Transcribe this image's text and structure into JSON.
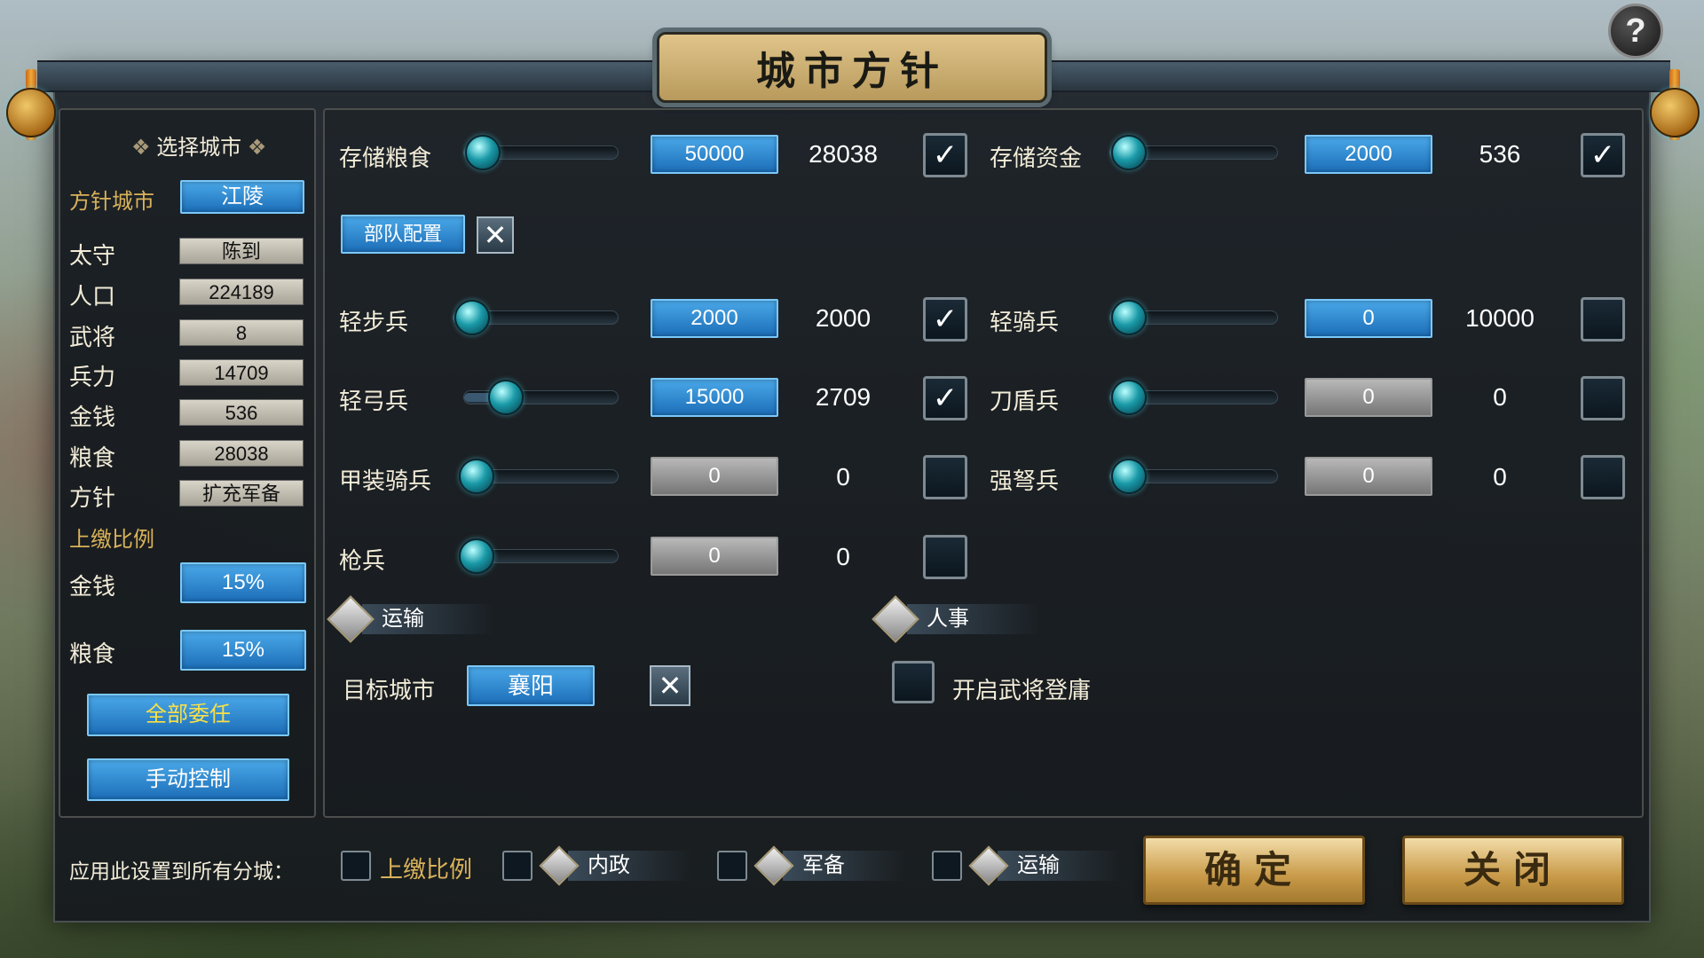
{
  "title": "城市方针",
  "help": "?",
  "left": {
    "header": "选择城市",
    "policy_city_label": "方针城市",
    "policy_city": "江陵",
    "stats": [
      {
        "label": "太守",
        "value": "陈到"
      },
      {
        "label": "人口",
        "value": "224189"
      },
      {
        "label": "武将",
        "value": "8"
      },
      {
        "label": "兵力",
        "value": "14709"
      },
      {
        "label": "金钱",
        "value": "536"
      },
      {
        "label": "粮食",
        "value": "28038"
      },
      {
        "label": "方针",
        "value": "扩充军备"
      }
    ],
    "tribute_header": "上缴比例",
    "tribute": [
      {
        "label": "金钱",
        "value": "15%"
      },
      {
        "label": "粮食",
        "value": "15%"
      }
    ],
    "delegate_all": "全部委任",
    "manual": "手动控制"
  },
  "main": {
    "store_food": {
      "label": "存储粮食",
      "target": "50000",
      "current": "28038",
      "checked": "✓",
      "level": 0.05
    },
    "store_money": {
      "label": "存储资金",
      "target": "2000",
      "current": "536",
      "checked": "✓",
      "level": 0.05
    },
    "troop_config": "部队配置",
    "troop_close": "✕",
    "troops": [
      {
        "label": "轻步兵",
        "target": "2000",
        "current": "2000",
        "checked": "✓",
        "level": 0.05
      },
      {
        "label": "轻骑兵",
        "target": "0",
        "current": "10000",
        "checked": "",
        "level": 0.05
      },
      {
        "label": "轻弓兵",
        "target": "15000",
        "current": "2709",
        "checked": "✓",
        "level": 0.25
      },
      {
        "label": "刀盾兵",
        "target": "0",
        "current": "0",
        "checked": "",
        "level": 0.05
      },
      {
        "label": "甲装骑兵",
        "target": "0",
        "current": "0",
        "checked": "",
        "level": 0.0
      },
      {
        "label": "强弩兵",
        "target": "0",
        "current": "0",
        "checked": "",
        "level": 0.05
      },
      {
        "label": "枪兵",
        "target": "0",
        "current": "0",
        "checked": "",
        "level": 0.0
      }
    ],
    "transport_header": "运输",
    "personnel_header": "人事",
    "target_city_label": "目标城市",
    "target_city": "襄阳",
    "target_close": "✕",
    "recruit_label": "开启武将登庸"
  },
  "footer": {
    "apply_label": "应用此设置到所有分城：",
    "opts": [
      "上缴比例",
      "内政",
      "军备",
      "运输"
    ],
    "confirm": "确定",
    "close": "关闭"
  }
}
